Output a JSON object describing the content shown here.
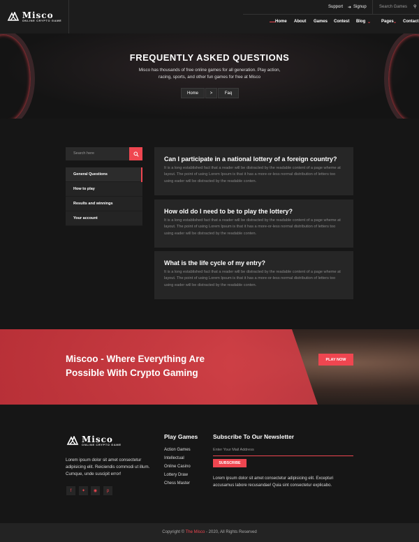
{
  "brand": {
    "name": "Misco",
    "tagline": "ONLINE CRYPTO GAME",
    "accent": "#ef4650"
  },
  "topbar": {
    "support": "Support",
    "signup": "Signup",
    "search_placeholder": "Search Games"
  },
  "nav": {
    "items": [
      "Home",
      "About",
      "Games",
      "Contest",
      "Blog",
      "Pages",
      "Contact"
    ]
  },
  "hero": {
    "title": "FREQUENTLY ASKED QUESTIONS",
    "description": "Misco has thousands of free online games for all generation. Play action, racing, sports, and other fun games for free at Misco",
    "breadcrumb": {
      "home": "Home",
      "separator": ">",
      "current": "Faq"
    }
  },
  "sidebar": {
    "search_placeholder": "Search here",
    "items": [
      "General Questions",
      "How to play",
      "Results and winnings",
      "Your account"
    ]
  },
  "faq": [
    {
      "question": "Can I participate in a national lottery of a foreign country?",
      "answer": "It is a long established fact that a reader will be distracted by the readable content of a page wheme at layout. The point of using Lorem Ipsum is that it has a more-or-less normal distribution of letters too using eader will be distracted by the readable conten."
    },
    {
      "question": "How old do I need to be to play the lottery?",
      "answer": "It is a long established fact that a reader will be distracted by the readable content of a page wheme at layout. The point of using Lorem Ipsum is that it has a more-or-less normal distribution of letters too using eader will be distracted by the readable conten."
    },
    {
      "question": "What is the life cycle of my entry?",
      "answer": "It is a long established fact that a reader will be distracted by the readable content of a page wheme at layout. The point of using Lorem Ipsum is that it has a more-or-less normal distribution of letters too using eader will be distracted by the readable conten."
    }
  ],
  "banner": {
    "title": "Miscoo - Where Everything Are Possible With Crypto Gaming",
    "button": "PLAY NOW"
  },
  "footer": {
    "about": "Lorem ipsum dolor sit amet consectetur adipisicing elit. Reiciendis commodi ut illum. Cumque, unde suscipit error!",
    "social": [
      "f",
      "t",
      "ig",
      "p"
    ],
    "play_games": {
      "title": "Play Games",
      "links": [
        "Action Games",
        "Intellectual",
        "Online Casino",
        "Lottery Draw",
        "Chess Master"
      ]
    },
    "newsletter": {
      "title": "Subscribe To Our Newsletter",
      "placeholder": "Enter Your Mail Address",
      "button": "SUBSCRIBE",
      "description": "Lorem ipsum dolor sit amet consectetur adipisicing elit. Excepturi accusamus labore recusandae! Quia sint consectetur explicabo."
    },
    "copyright": {
      "prefix": "Copyright ©",
      "brand": "The Misco",
      "suffix": "- 2020, All Rights Reserved"
    }
  }
}
